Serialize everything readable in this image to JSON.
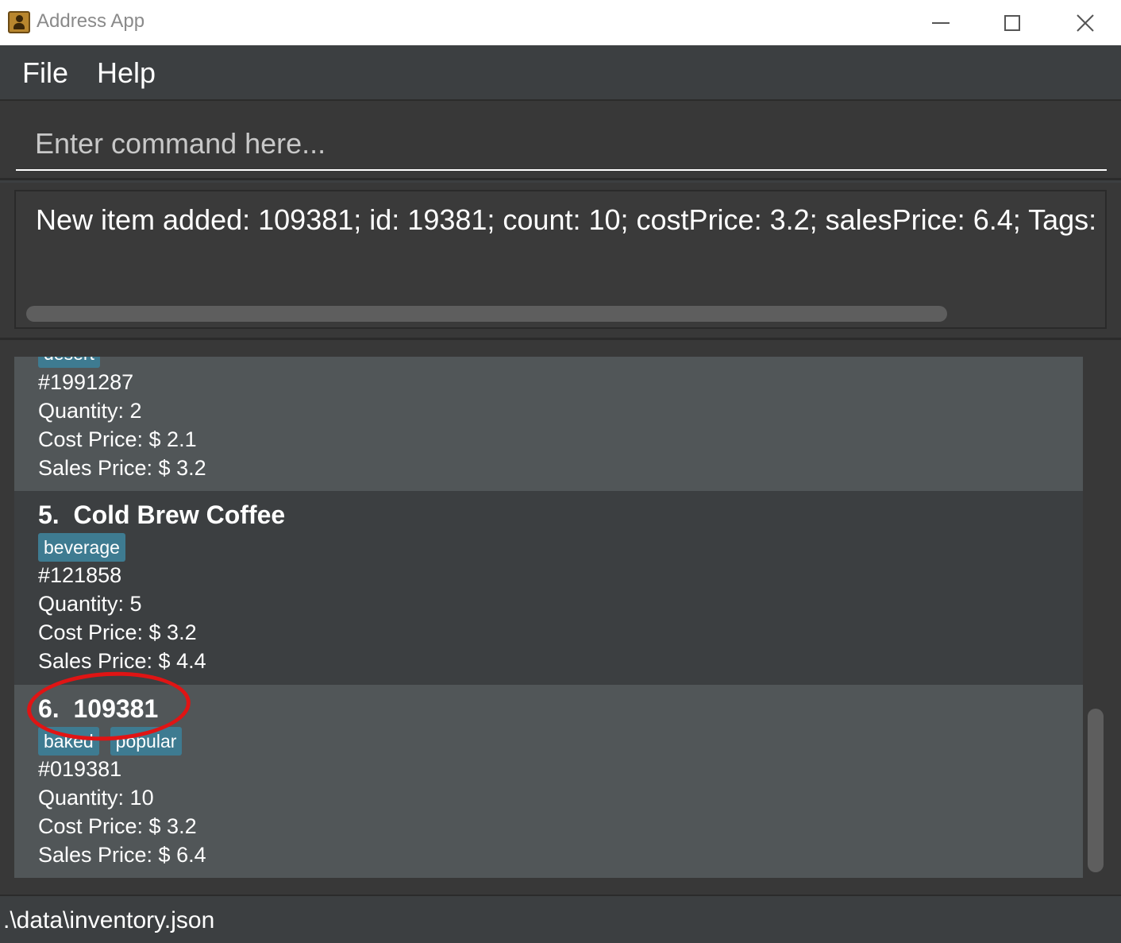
{
  "window": {
    "title": "Address App",
    "icon": "address-book-icon"
  },
  "menu": {
    "file": "File",
    "help": "Help"
  },
  "command": {
    "placeholder": "Enter command here...",
    "value": ""
  },
  "result": {
    "text": "New item added: 109381; id: 19381; count: 10; costPrice: 3.2; salesPrice: 6.4; Tags: [baked][popular]"
  },
  "items": [
    {
      "title": "",
      "tags": [
        "desert"
      ],
      "id": "#1991287",
      "quantity": "Quantity: 2",
      "cost": "Cost Price: $ 2.1",
      "sales": "Sales Price: $ 3.2"
    },
    {
      "title": "5.  Cold Brew Coffee",
      "tags": [
        "beverage"
      ],
      "id": "#121858",
      "quantity": "Quantity: 5",
      "cost": "Cost Price: $ 3.2",
      "sales": "Sales Price: $ 4.4"
    },
    {
      "title": "6.  109381",
      "tags": [
        "baked",
        "popular"
      ],
      "id": "#019381",
      "quantity": "Quantity: 10",
      "cost": "Cost Price: $ 3.2",
      "sales": "Sales Price: $ 6.4"
    }
  ],
  "status": {
    "path": ".\\data\\inventory.json"
  },
  "colors": {
    "tag_bg": "#3e7b91",
    "annotation": "#e01414",
    "card_light": "#515658",
    "card_dark": "#3c3f41"
  }
}
